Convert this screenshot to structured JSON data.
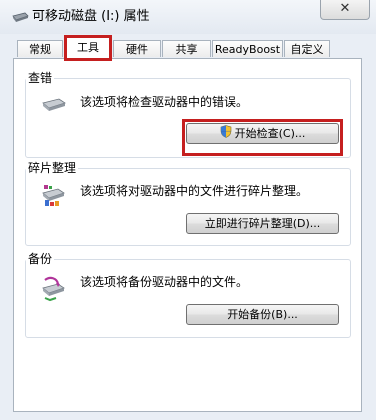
{
  "window": {
    "title": "可移动磁盘 (I:) 属性",
    "close_glyph": "✕",
    "title_icon": "removable-disk-icon"
  },
  "tabs": [
    {
      "label": "常规",
      "selected": false
    },
    {
      "label": "工具",
      "selected": true
    },
    {
      "label": "硬件",
      "selected": false
    },
    {
      "label": "共享",
      "selected": false
    },
    {
      "label": "ReadyBoost",
      "selected": false
    },
    {
      "label": "自定义",
      "selected": false
    }
  ],
  "sections": {
    "error_check": {
      "title": "查错",
      "description": "该选项将检查驱动器中的错误。",
      "button_label": "开始检查(C)...",
      "icon": "drive-check-icon",
      "button_icon": "uac-shield-icon"
    },
    "defrag": {
      "title": "碎片整理",
      "description": "该选项将对驱动器中的文件进行碎片整理。",
      "button_label": "立即进行碎片整理(D)...",
      "icon": "defrag-icon"
    },
    "backup": {
      "title": "备份",
      "description": "该选项将备份驱动器中的文件。",
      "button_label": "开始备份(B)...",
      "icon": "backup-icon"
    }
  },
  "colors": {
    "highlight": "#c51f1f",
    "window_bg": "#e9eef5",
    "panel_bg": "#ffffff"
  }
}
